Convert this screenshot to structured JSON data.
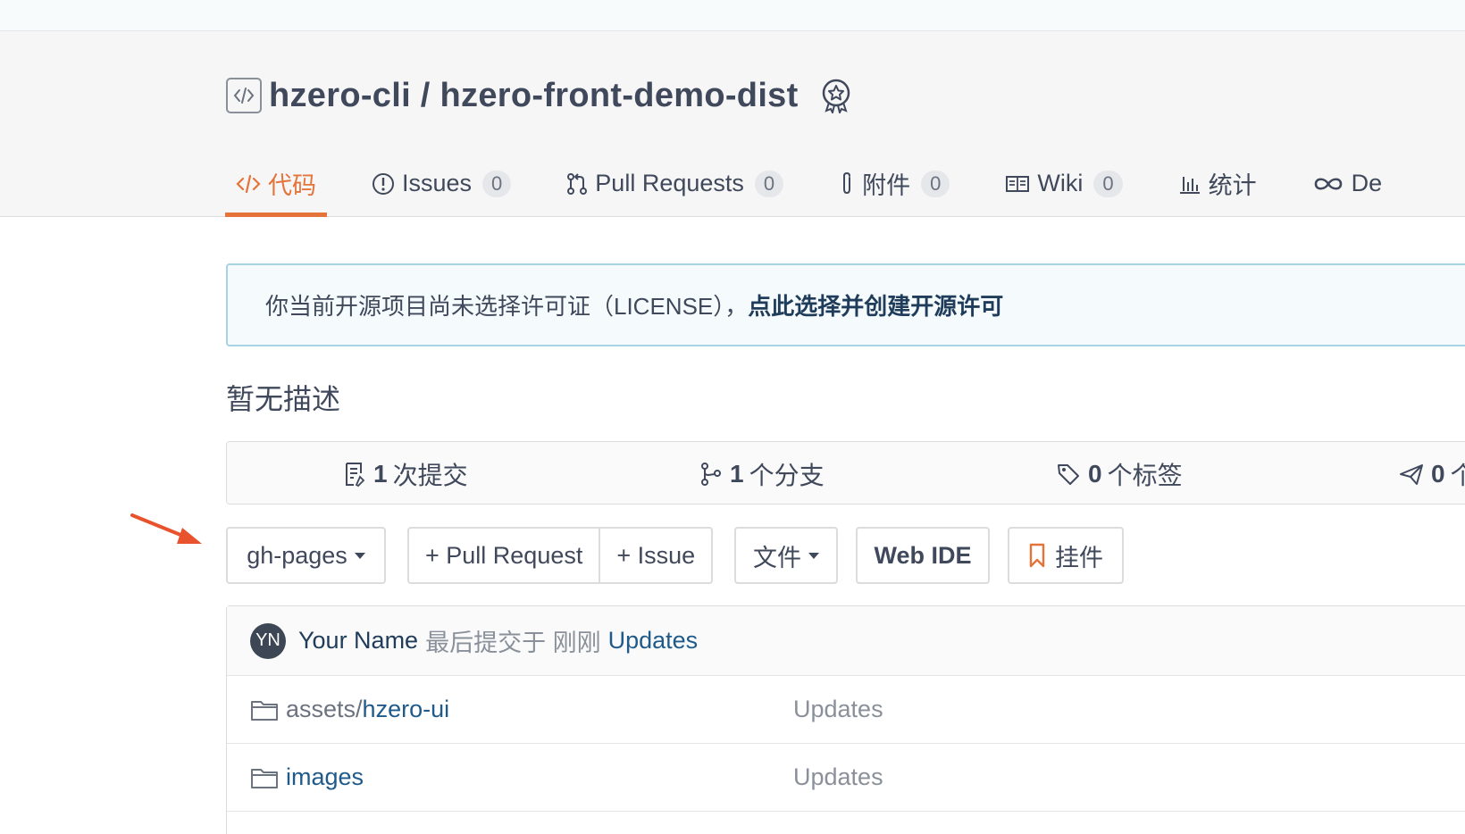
{
  "repo": {
    "owner": "hzero-cli",
    "separator": " / ",
    "name": "hzero-front-demo-dist"
  },
  "tabs": [
    {
      "label": "代码",
      "icon": "code-icon",
      "active": true
    },
    {
      "label": "Issues",
      "count": "0",
      "icon": "issue-icon"
    },
    {
      "label": "Pull Requests",
      "count": "0",
      "icon": "pull-request-icon"
    },
    {
      "label": "附件",
      "count": "0",
      "icon": "paperclip-icon"
    },
    {
      "label": "Wiki",
      "count": "0",
      "icon": "book-icon"
    },
    {
      "label": "统计",
      "icon": "bar-chart-icon"
    },
    {
      "label": "De",
      "icon": "infinity-icon"
    }
  ],
  "license": {
    "text": "你当前开源项目尚未选择许可证（LICENSE），",
    "link": "点此选择并创建开源许可"
  },
  "description": "暂无描述",
  "stats": [
    {
      "count": "1",
      "label": "次提交",
      "icon": "commit-icon"
    },
    {
      "count": "1",
      "label": "个分支",
      "icon": "branch-icon"
    },
    {
      "count": "0",
      "label": "个标签",
      "icon": "tag-icon"
    },
    {
      "count": "0",
      "label": "个",
      "icon": "release-icon"
    }
  ],
  "toolbar": {
    "branch": "gh-pages",
    "pull_request": "+ Pull Request",
    "issue": "+ Issue",
    "files": "文件",
    "web_ide": "Web IDE",
    "widget": "挂件"
  },
  "commit": {
    "avatar_initials": "YN",
    "author": "Your Name",
    "meta": "最后提交于 刚刚",
    "message": "Updates"
  },
  "files": [
    {
      "prefix": "assets/",
      "name": "hzero-ui",
      "message": "Updates",
      "icon": "folder-icon"
    },
    {
      "prefix": "",
      "name": "images",
      "message": "Updates",
      "icon": "folder-icon"
    }
  ],
  "colors": {
    "accent": "#e4743a",
    "link": "#1f5a8a",
    "annotation_arrow": "#e8522c"
  }
}
